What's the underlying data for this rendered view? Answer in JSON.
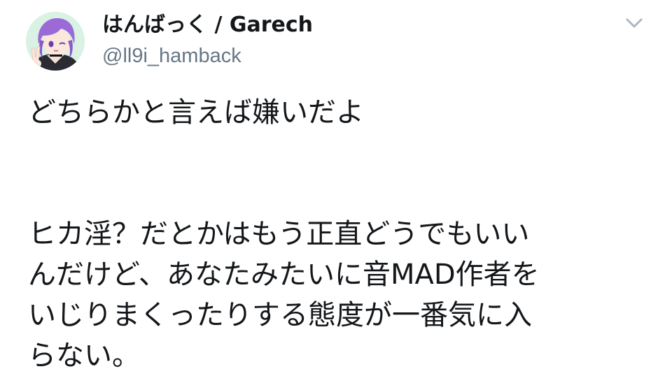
{
  "user": {
    "display_name": "はんばっく / Garech",
    "handle": "@ll9i_hamback",
    "avatar_icon": "user-avatar-icon"
  },
  "tweet": {
    "paragraph_1": [
      "どちらかと言えば嫌いだよ"
    ],
    "paragraph_2": [
      "ヒカ淫？だとかはもう正直どうでもいい",
      "んだけど、あなたみたいに音MAD作者を",
      "いじりまくったりする態度が一番気に入",
      "らない。"
    ]
  },
  "menu": {
    "caret_icon": "chevron-down-icon"
  },
  "colors": {
    "text_primary": "#14171a",
    "text_secondary": "#657786",
    "caret": "#aab8c2",
    "avatar_bg": "#d9f2e4",
    "hair": "#9b6ad6"
  }
}
